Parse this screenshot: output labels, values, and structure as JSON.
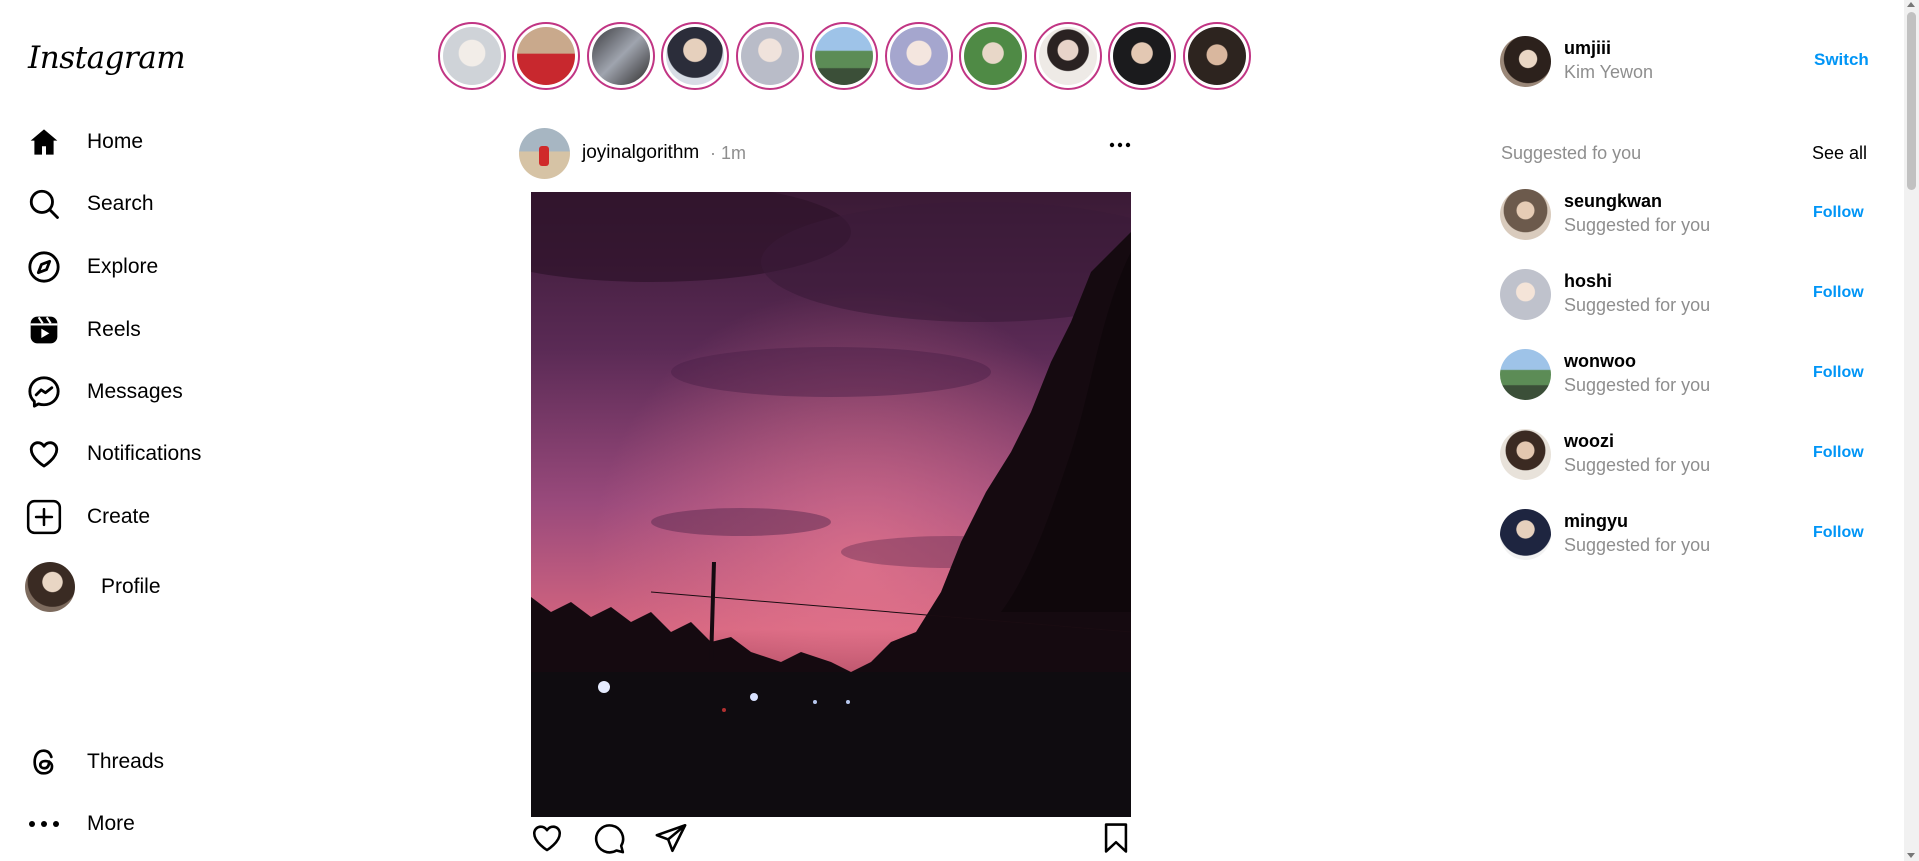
{
  "app": {
    "logo": "Instagram"
  },
  "sidebar": {
    "items": [
      {
        "label": "Home",
        "icon": "home-icon"
      },
      {
        "label": "Search",
        "icon": "search-icon"
      },
      {
        "label": "Explore",
        "icon": "compass-icon"
      },
      {
        "label": "Reels",
        "icon": "reels-icon"
      },
      {
        "label": "Messages",
        "icon": "messenger-icon"
      },
      {
        "label": "Notifications",
        "icon": "heart-icon"
      },
      {
        "label": "Create",
        "icon": "plus-square-icon"
      },
      {
        "label": "Profile",
        "icon": "avatar"
      }
    ],
    "bottom": [
      {
        "label": "Threads",
        "icon": "threads-icon"
      },
      {
        "label": "More",
        "icon": "more-dots-icon"
      }
    ]
  },
  "stories": {
    "count": 11,
    "ring_color": "#c13584"
  },
  "post": {
    "username": "joyinalgorithm",
    "time": "· 1m",
    "actions": [
      "heart-icon",
      "comment-icon",
      "share-icon",
      "bookmark-icon"
    ]
  },
  "account": {
    "username": "umjiii",
    "full_name": "Kim Yewon",
    "switch_label": "Switch"
  },
  "suggestions": {
    "title": "Suggested fo you",
    "see_all": "See all",
    "follow_label": "Follow",
    "subtitle": "Suggested for you",
    "users": [
      "seungkwan",
      "hoshi",
      "wonwoo",
      "woozi",
      "mingyu"
    ]
  },
  "colors": {
    "accent": "#0095f6",
    "muted": "#8e8e8e",
    "story_ring": "#c13584"
  }
}
